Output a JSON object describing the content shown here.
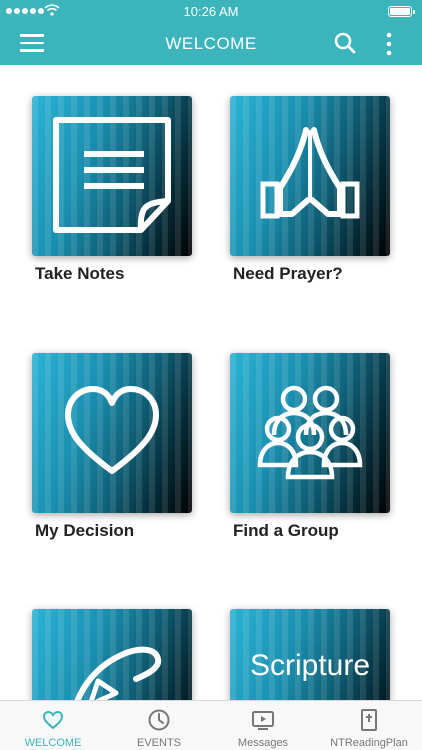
{
  "status_bar": {
    "time": "10:26 AM",
    "signal_dots": 5,
    "battery": "full"
  },
  "nav_bar": {
    "title": "WELCOME",
    "accent_color": "#3cb4bb",
    "icons": [
      "menu-icon",
      "search-icon",
      "more-vertical-icon"
    ]
  },
  "tiles": [
    {
      "label": "Take Notes",
      "icon": "note-icon"
    },
    {
      "label": "Need Prayer?",
      "icon": "praying-hands-icon"
    },
    {
      "label": "My Decision",
      "icon": "heart-icon"
    },
    {
      "label": "Find a Group",
      "icon": "group-icon"
    },
    {
      "label": "",
      "icon": "hand-icon"
    },
    {
      "label": "",
      "icon": "scripture-text",
      "tile_text": "Scripture"
    }
  ],
  "tab_bar": {
    "active_color": "#3cb4bb",
    "tabs": [
      {
        "label": "WELCOME",
        "icon": "heart-icon",
        "active": true
      },
      {
        "label": "EVENTS",
        "icon": "clock-icon",
        "active": false
      },
      {
        "label": "Messages",
        "icon": "tv-play-icon",
        "active": false
      },
      {
        "label": "NTReadingPlan",
        "icon": "bible-icon",
        "active": false
      }
    ]
  }
}
